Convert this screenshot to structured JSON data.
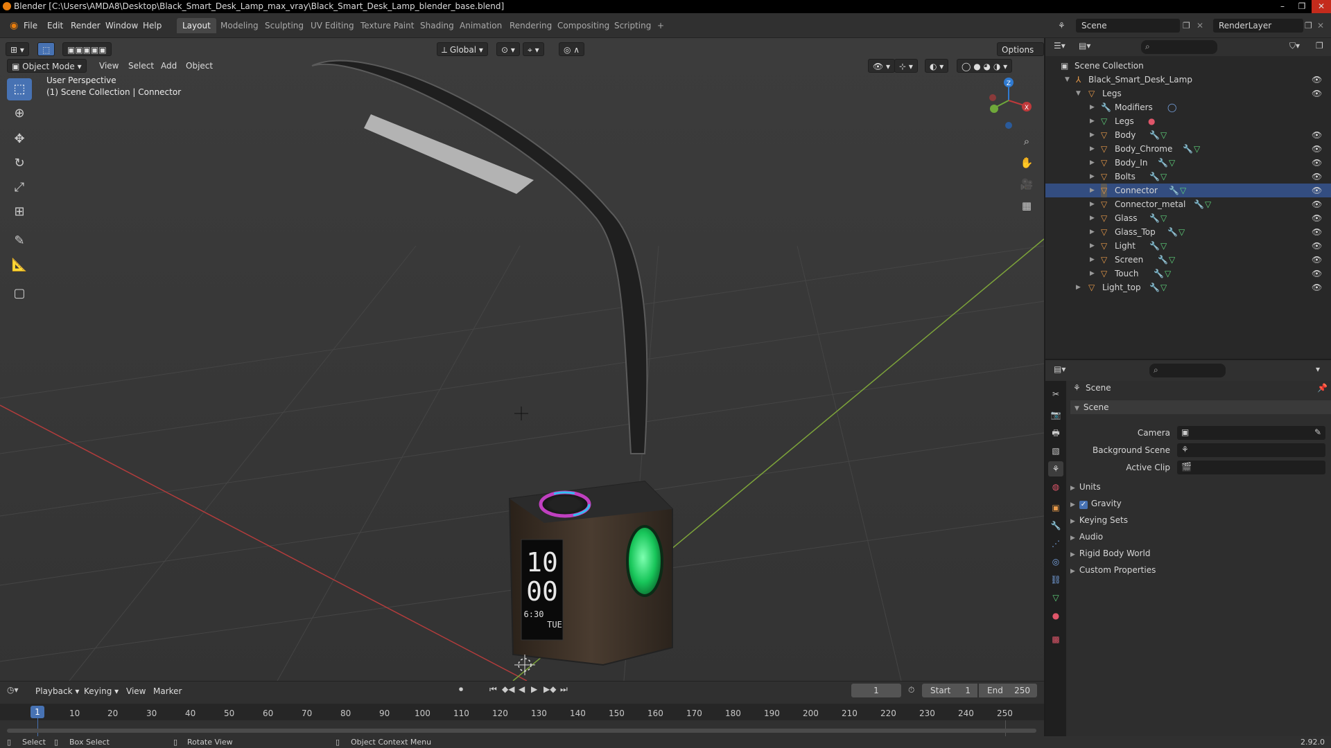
{
  "titlebar": {
    "title": "Blender [C:\\Users\\AMDA8\\Desktop\\Black_Smart_Desk_Lamp_max_vray\\Black_Smart_Desk_Lamp_blender_base.blend]",
    "minimize": "–",
    "restore": "❐",
    "close": "✕"
  },
  "menubar": {
    "items": [
      "File",
      "Edit",
      "Render",
      "Window",
      "Help"
    ],
    "workspaces": [
      "Layout",
      "Modeling",
      "Sculpting",
      "UV Editing",
      "Texture Paint",
      "Shading",
      "Animation",
      "Rendering",
      "Compositing",
      "Scripting"
    ],
    "active_workspace": "Layout",
    "add_tab": "+",
    "scene_label": "Scene",
    "renderlayer_label": "RenderLayer"
  },
  "viewport": {
    "mode": "Object Mode",
    "menus": [
      "View",
      "Select",
      "Add",
      "Object"
    ],
    "transform": "Global",
    "options": "Options",
    "overlay_title": "User Perspective",
    "overlay_subtitle": "(1) Scene Collection | Connector",
    "gizmo": {
      "z": "Z",
      "x": "X"
    },
    "clock": {
      "hour": "10",
      "minute": "00",
      "time_small": "6:30",
      "day": "TUE"
    }
  },
  "outliner": {
    "root": "Scene Collection",
    "collection": "Black_Smart_Desk_Lamp",
    "parent": "Legs",
    "modifiers": "Modifiers",
    "children": [
      "Legs",
      "Body",
      "Body_Chrome",
      "Body_In",
      "Bolts",
      "Connector",
      "Connector_metal",
      "Glass",
      "Glass_Top",
      "Light",
      "Screen",
      "Touch"
    ],
    "sibling": "Light_top"
  },
  "properties": {
    "context": "Scene",
    "panel": "Scene",
    "fields": [
      "Camera",
      "Background Scene",
      "Active Clip"
    ],
    "subpanels": [
      "Units",
      "Gravity",
      "Keying Sets",
      "Audio",
      "Rigid Body World",
      "Custom Properties"
    ],
    "gravity_checked": true
  },
  "timeline": {
    "menus": [
      "Playback",
      "Keying",
      "View",
      "Marker"
    ],
    "current_frame": "1",
    "start_label": "Start",
    "start": "1",
    "end_label": "End",
    "end": "250",
    "ticks": [
      "10",
      "20",
      "30",
      "40",
      "50",
      "60",
      "70",
      "80",
      "90",
      "100",
      "110",
      "120",
      "130",
      "140",
      "150",
      "160",
      "170",
      "180",
      "190",
      "200",
      "210",
      "220",
      "230",
      "240",
      "250"
    ]
  },
  "statusbar": {
    "select": "Select",
    "box_select": "Box Select",
    "rotate": "Rotate View",
    "context_menu": "Object Context Menu",
    "version": "2.92.0"
  },
  "colors": {
    "accent": "#4772b3",
    "object_orange": "#e79a4a",
    "x_axis": "#c0393b",
    "y_axis": "#6fa83a",
    "z_axis": "#2f7ad1"
  }
}
